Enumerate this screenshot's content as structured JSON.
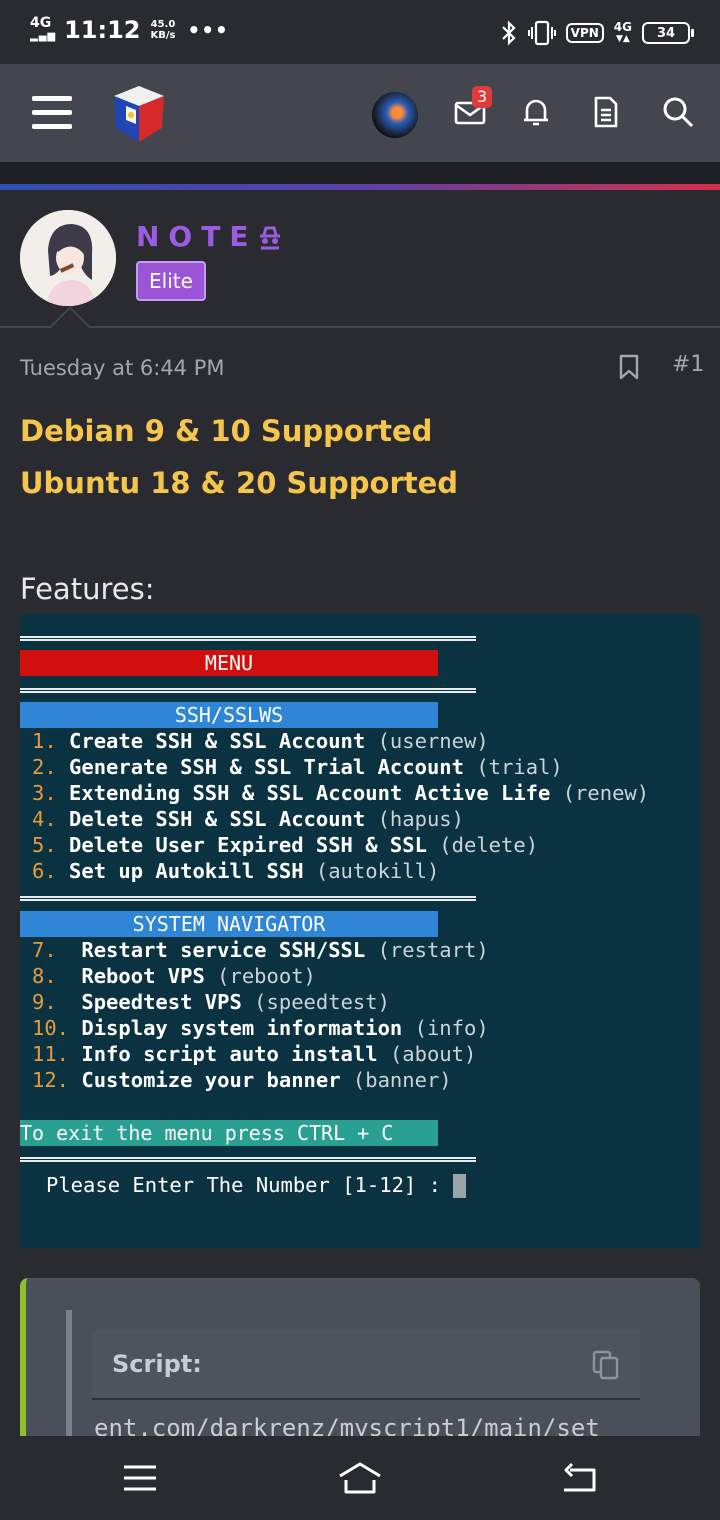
{
  "status_bar": {
    "network": "4G",
    "time": "11:12",
    "speed_value": "45.0",
    "speed_unit": "KB/s",
    "overflow": "•••",
    "vpn": "VPN",
    "mobile": "4G",
    "battery": "34"
  },
  "header": {
    "notification_badge": "3",
    "icons": [
      "menu-icon",
      "site-logo",
      "user-avatar",
      "mail-icon",
      "bell-icon",
      "document-icon",
      "search-icon"
    ]
  },
  "post": {
    "username": "NOTE",
    "rank": "Elite",
    "date": "Tuesday at 6:44 PM",
    "number": "#1",
    "line1": "Debian 9 & 10 Supported",
    "line2": "Ubuntu 18 & 20 Supported",
    "features_label": "Features:"
  },
  "terminal": {
    "menu_title": "MENU",
    "section1_title": "SSH/SSLWS",
    "section1_items": [
      {
        "num": "1.",
        "cmd": "Create SSH & SSL Account",
        "alias": "(usernew)"
      },
      {
        "num": "2.",
        "cmd": "Generate SSH & SSL Trial Account",
        "alias": "(trial)"
      },
      {
        "num": "3.",
        "cmd": "Extending SSH & SSL Account Active Life",
        "alias": "(renew)"
      },
      {
        "num": "4.",
        "cmd": "Delete SSH & SSL Account",
        "alias": "(hapus)"
      },
      {
        "num": "5.",
        "cmd": "Delete User Expired SSH & SSL",
        "alias": "(delete)"
      },
      {
        "num": "6.",
        "cmd": "Set up Autokill SSH",
        "alias": "(autokill)"
      }
    ],
    "section2_title": "SYSTEM NAVIGATOR",
    "section2_items": [
      {
        "num": "7. ",
        "cmd": "Restart service SSH/SSL",
        "alias": "(restart)"
      },
      {
        "num": "8. ",
        "cmd": "Reboot VPS",
        "alias": "(reboot)"
      },
      {
        "num": "9. ",
        "cmd": "Speedtest VPS",
        "alias": "(speedtest)"
      },
      {
        "num": "10.",
        "cmd": "Display system information",
        "alias": "(info)"
      },
      {
        "num": "11.",
        "cmd": "Info script auto install",
        "alias": "(about)"
      },
      {
        "num": "12.",
        "cmd": "Customize your banner",
        "alias": "(banner)"
      }
    ],
    "exit_hint": "To exit the menu press CTRL + C",
    "prompt": "Please Enter The Number [1-12] :",
    "colors": {
      "background": "#0b3240",
      "menu_bar": "#d10f0f",
      "section_bar": "#2f86d6",
      "exit_bar": "#29a091",
      "number": "#e79a3d"
    }
  },
  "code_block": {
    "title": "Script:",
    "code": "ent.com/darkrenz/myscript1/main/set"
  },
  "colors": {
    "accent": "#9a5ce0",
    "highlight": "#f5c64b",
    "code_border": "#8fbf2a"
  }
}
